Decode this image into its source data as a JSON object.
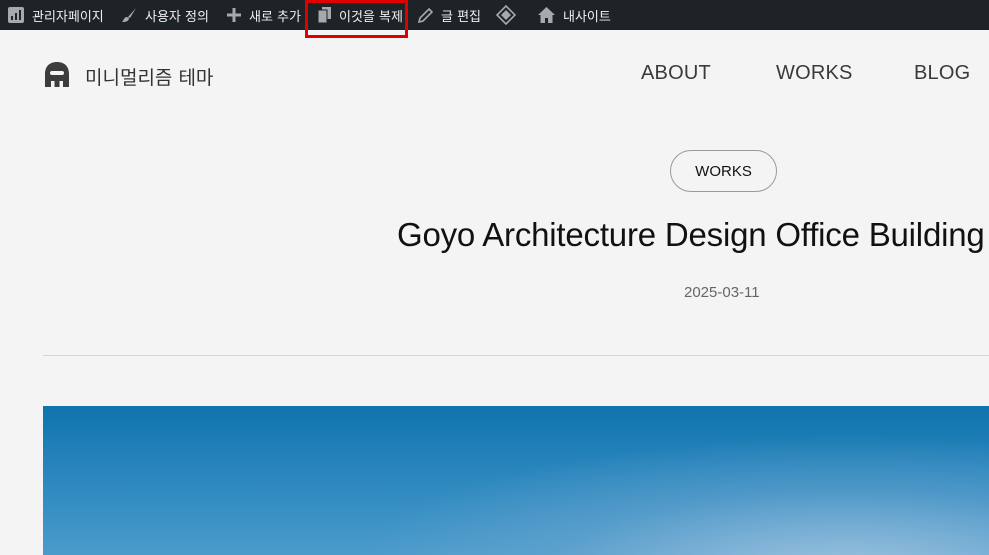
{
  "adminbar": {
    "dashboard_label": "관리자페이지",
    "customize_label": "사용자 정의",
    "new_label": "새로 추가",
    "duplicate_label": "이것을 복제",
    "edit_label": "글 편집",
    "site_label": "내사이트"
  },
  "header": {
    "logo_text": "미니멀리즘 테마",
    "nav": [
      "ABOUT",
      "WORKS",
      "BLOG"
    ]
  },
  "post": {
    "category": "WORKS",
    "title": "Goyo Architecture Design Office Building",
    "date": "2025-03-11"
  },
  "icons": {
    "dashboard": "dashboard-icon",
    "customize": "paintbrush-icon",
    "new": "plus-icon",
    "duplicate": "copy-icon",
    "edit": "pencil-icon",
    "diamond": "diamond-icon",
    "site": "home-icon",
    "logo": "ghost-logo-icon"
  },
  "colors": {
    "adminbar_bg": "#1d2327",
    "highlight": "#e00000",
    "page_bg": "#f4f4f4"
  }
}
